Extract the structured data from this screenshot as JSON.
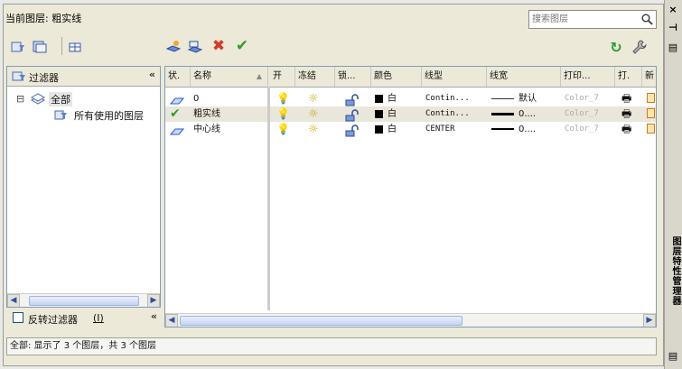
{
  "app": {
    "current_layer_label": "当前图层: 粗实线",
    "search_placeholder": "搜索图层",
    "strip_title": "图层特性管理器",
    "strip_close": "×",
    "strip_autohide": "⊣",
    "strip_props": "▤"
  },
  "toolbar": {
    "left_buttons": [
      "new-property-filter-icon",
      "new-group-filter-icon",
      "layer-states-manager-icon"
    ],
    "right_buttons": [
      "new-layer-icon",
      "new-layer-vp-frozen-icon",
      "delete-layer-icon",
      "set-current-icon"
    ],
    "refresh_icon": "refresh-icon",
    "settings_icon": "wrench-icon"
  },
  "filters": {
    "header_label": "过滤器",
    "collapse_glyph": "«",
    "tree": [
      {
        "label": "全部",
        "expander": "⊟"
      },
      {
        "label": "所有使用的图层"
      }
    ],
    "invert_label": "反转过滤器",
    "invert_hotkey": "(I)",
    "invert_checked": false
  },
  "grid": {
    "columns": [
      "状.",
      "名称",
      "开",
      "冻结",
      "锁...",
      "颜色",
      "线型",
      "线宽",
      "打印...",
      "打.",
      "新"
    ],
    "rows": [
      {
        "status": "layer",
        "name": "0",
        "color_name": "白",
        "linetype": "Contin...",
        "lineweight": "默认",
        "plot_style": "Color_7",
        "selected": false
      },
      {
        "status": "current",
        "name": "粗实线",
        "color_name": "白",
        "linetype": "Contin...",
        "lineweight": "0....",
        "plot_style": "Color_7",
        "selected": true
      },
      {
        "status": "layer",
        "name": "中心线",
        "color_name": "白",
        "linetype": "CENTER",
        "lineweight": "0....",
        "plot_style": "Color_7",
        "selected": false
      }
    ]
  },
  "status": {
    "text": "全部: 显示了 3 个图层，共 3 个图层"
  },
  "colors": {
    "accent_green": "#2e9b2e",
    "delete_red": "#d23a2a",
    "layer_blue": "#2a5bd7",
    "bulb_yellow": "#f2d23a"
  }
}
